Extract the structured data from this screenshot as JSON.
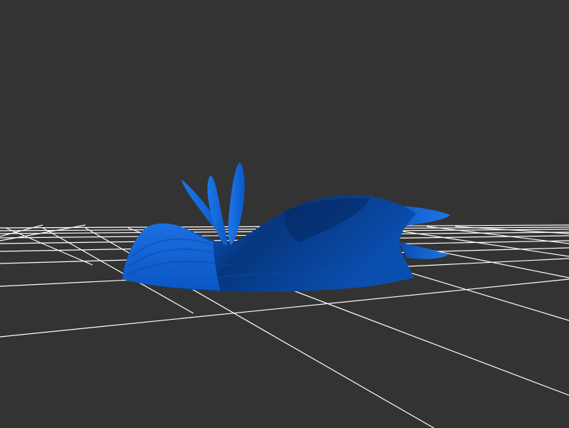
{
  "viewport": {
    "background_color": "#333333",
    "grid_color": "#ffffff",
    "model_color": "#0a5fd6",
    "model_shadow_color": "#062f6e",
    "model_highlight_color": "#2b86f0"
  }
}
